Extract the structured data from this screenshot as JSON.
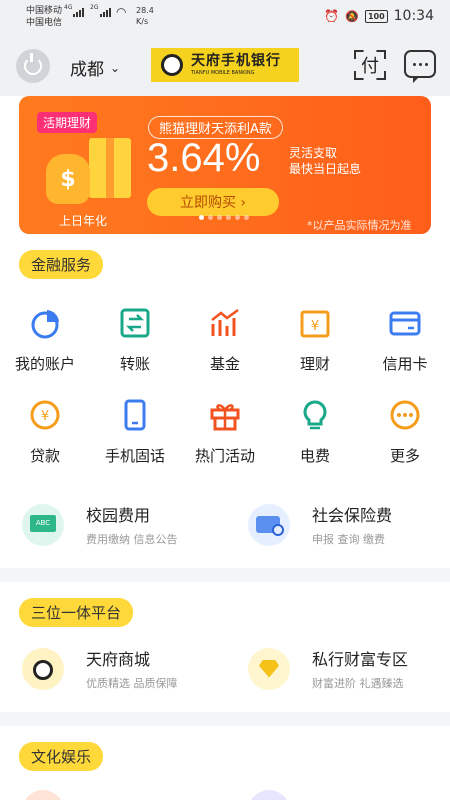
{
  "status": {
    "carrier1": "中国移动",
    "carrier2": "中国电信",
    "net1": "4G",
    "net2": "2G",
    "speed": "28.4",
    "speed_unit": "K/s",
    "battery": "100",
    "time": "10:34"
  },
  "header": {
    "city": "成都",
    "logo_cn": "天府手机银行",
    "logo_en": "TIANFU MOBILE BANKING",
    "scan_label": "付"
  },
  "banner": {
    "tag": "活期理财",
    "product": "熊猫理财天添利A款",
    "rate": "3.64%",
    "feature1": "灵活支取",
    "feature2": "最快当日起息",
    "button": "立即购买 ›",
    "annual": "上日年化",
    "note": "*以产品实际情况为准",
    "coin": "$",
    "dot_count": 6
  },
  "sections": {
    "finance": "金融服务",
    "platform": "三位一体平台",
    "culture": "文化娱乐"
  },
  "services": [
    {
      "label": "我的账户",
      "icon": "pie-chart-icon",
      "color": "#3b7cf0"
    },
    {
      "label": "转账",
      "icon": "transfer-icon",
      "color": "#1aa88a"
    },
    {
      "label": "基金",
      "icon": "fund-chart-icon",
      "color": "#f0531f"
    },
    {
      "label": "理财",
      "icon": "wealth-card-icon",
      "color": "#f59c1a"
    },
    {
      "label": "信用卡",
      "icon": "credit-card-icon",
      "color": "#3b7cf0"
    },
    {
      "label": "贷款",
      "icon": "yen-coin-icon",
      "color": "#f59c1a"
    },
    {
      "label": "手机固话",
      "icon": "phone-icon",
      "color": "#3b7cf0"
    },
    {
      "label": "热门活动",
      "icon": "gift-icon",
      "color": "#f0531f"
    },
    {
      "label": "电费",
      "icon": "bulb-icon",
      "color": "#1aa88a"
    },
    {
      "label": "更多",
      "icon": "more-icon",
      "color": "#f59c1a"
    }
  ],
  "campus": {
    "title": "校园费用",
    "sub": "费用缴纳  信息公告"
  },
  "insurance": {
    "title": "社会保险费",
    "sub": "申报 查询 缴费"
  },
  "mall": {
    "title": "天府商城",
    "sub": "优质精选 品质保障"
  },
  "private": {
    "title": "私行财富专区",
    "sub": "财富进阶 礼遇臻选"
  }
}
